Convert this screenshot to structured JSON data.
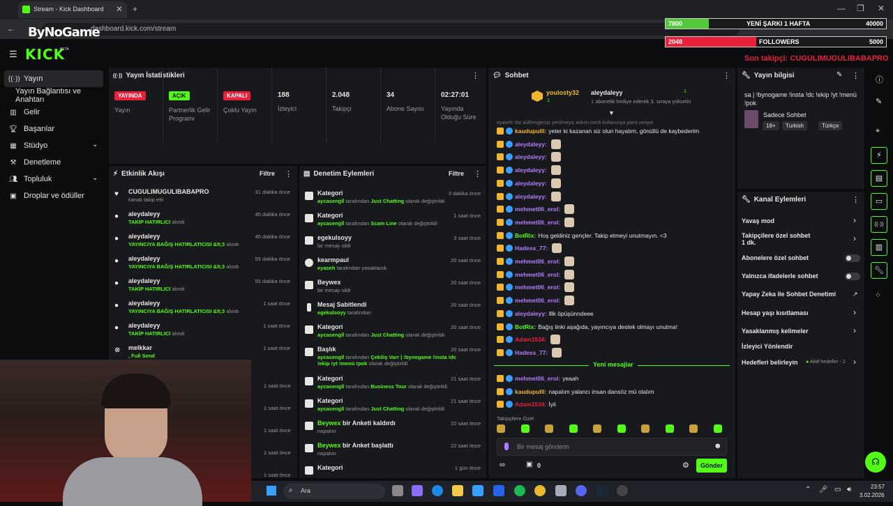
{
  "browser": {
    "tab_title": "Stream - Kick Dashboard",
    "url": "dashboard.kick.com/stream",
    "overlay_logo": "ByNoGame"
  },
  "overlay": {
    "song_count": "7800",
    "song_label": "YENİ ŞARKI 1 HAFTA",
    "song_target": "40000",
    "follow_count": "2048",
    "follow_label": "FOLLOWERS",
    "follow_target": "5000",
    "last_follower": "Son takipçi: CUGULIMUGULIBABAPRO",
    "song_progress": 0.195,
    "follow_progress": 0.41
  },
  "kick": {
    "logo": "KICK",
    "beta": "BETA"
  },
  "sidebar": {
    "items": [
      {
        "label": "Yayın",
        "icon": "broadcast-icon"
      },
      {
        "label": "Yayın Bağlantısı ve Anahtarı",
        "icon": ""
      },
      {
        "label": "Gelir",
        "icon": "chart-icon"
      },
      {
        "label": "Başarılar",
        "icon": "trophy-icon"
      },
      {
        "label": "Stüdyo",
        "icon": "grid-icon"
      },
      {
        "label": "Denetleme",
        "icon": "hammer-icon"
      },
      {
        "label": "Topluluk",
        "icon": "users-icon"
      },
      {
        "label": "Droplar ve ödüller",
        "icon": "gift-icon"
      }
    ]
  },
  "stats": {
    "title": "Yayın İstatistikleri",
    "items": [
      {
        "badge": "YAYINDA",
        "label": "Yayın"
      },
      {
        "badge": "AÇIK",
        "label": "Partnerlik Gelir Programı"
      },
      {
        "badge": "KAPALI",
        "label": "Çoklu Yayın"
      },
      {
        "value": "188",
        "label": "İzleyici"
      },
      {
        "value": "2.048",
        "label": "Takipçi"
      },
      {
        "value": "34",
        "label": "Abone Sayısı"
      },
      {
        "value": "02:27:01",
        "label": "Yayında Olduğu Süre"
      }
    ]
  },
  "activity": {
    "title": "Etkinlik Akışı",
    "filter": "Filtre",
    "rows": [
      {
        "name": "CUGULIMUGULIBABAPRO",
        "sub": "",
        "sub2": "kanalı takip etti",
        "time": "31 dakika önce"
      },
      {
        "name": "aleydaleyy",
        "sub": "TAKİP HATIRLICI",
        "sub2": "alındı",
        "time": "45 dakika önce"
      },
      {
        "name": "aleydaleyy",
        "sub": "YAYINCIYA BAĞIŞ HATIRLATICISI &lt;3",
        "sub2": "alındı",
        "time": "45 dakika önce"
      },
      {
        "name": "aleydaleyy",
        "sub": "YAYINCIYA BAĞIŞ HATIRLATICISI &lt;3",
        "sub2": "alındı",
        "time": "55 dakika önce"
      },
      {
        "name": "aleydaleyy",
        "sub": "TAKİP HATIRLICI",
        "sub2": "alındı",
        "time": "55 dakika önce"
      },
      {
        "name": "aleydaleyy",
        "sub": "YAYINCIYA BAĞIŞ HATIRLATICISI &lt;3",
        "sub2": "alındı",
        "time": "1 saat önce"
      },
      {
        "name": "aleydaleyy",
        "sub": "TAKİP HATIRLICI",
        "sub2": "alındı",
        "time": "1 saat önce"
      },
      {
        "name": "melkkar",
        "sub": ", Full Send",
        "sub2": "",
        "time": "1 saat önce"
      }
    ],
    "extra_times": [
      "1 saat önce",
      "1 saat önce",
      "1 saat önce",
      "1 saat önce",
      "1 saat önce"
    ]
  },
  "moderation": {
    "title": "Denetim Eylemleri",
    "filter": "Filtre",
    "rows": [
      {
        "name": "Kategori",
        "g1": "aycasengll",
        "t1": " tarafından ",
        "g2": "Just Chatting",
        "t2": " olarak değiştirildi",
        "time": "3 dakika önce"
      },
      {
        "name": "Kategori",
        "g1": "aycasengll",
        "t1": " tarafından ",
        "g2": "Scam Line",
        "t2": " olarak değiştirildi",
        "time": "1 saat önce"
      },
      {
        "name": "egekulsoyy",
        "g1": "",
        "t1": "bir mesajı sildi",
        "g2": "",
        "t2": "",
        "time": "3 saat önce"
      },
      {
        "name": "kearmpaul",
        "g1": "eyaseh",
        "t1": " tarafından yasaklandı",
        "g2": "",
        "t2": "",
        "time": "20 saat önce"
      },
      {
        "name": "Beywex",
        "g1": "",
        "t1": "bir mesajı sildi",
        "g2": "",
        "t2": "",
        "time": "20 saat önce"
      },
      {
        "name": "Mesaj Sabitlendi",
        "g1": "egekulsoyy",
        "t1": " tarafından",
        "g2": "",
        "t2": "",
        "time": "20 saat önce"
      },
      {
        "name": "Kategori",
        "g1": "aycasengll",
        "t1": " tarafından ",
        "g2": "Just Chatting",
        "t2": " olarak değiştirildi",
        "time": "20 saat önce"
      },
      {
        "name": "Başlık",
        "g1": "aycasengll",
        "t1": " tarafından ",
        "g2": "Çekiliş Varr | !bynogame !insta !dc !ekip !yt !menü !pok",
        "t2": " olarak değiştirildi",
        "time": "20 saat önce"
      },
      {
        "name": "Kategori",
        "g1": "aycasengll",
        "t1": " tarafından ",
        "g2": "Business Tour",
        "t2": " olarak değiştirildi",
        "time": "21 saat önce"
      },
      {
        "name": "Kategori",
        "g1": "aycasengll",
        "t1": " tarafından ",
        "g2": "Just Chatting",
        "t2": " olarak değiştirildi",
        "time": "21 saat önce"
      },
      {
        "name": "bir Anketi kaldırdı",
        "gname": "Beywex",
        "g1": "",
        "t1": "napalım",
        "g2": "",
        "t2": "",
        "time": "22 saat önce"
      },
      {
        "name": "bir Anket başlattı",
        "gname": "Beywex",
        "g1": "",
        "t1": "napalım",
        "g2": "",
        "t2": "",
        "time": "22 saat önce"
      },
      {
        "name": "Kategori",
        "g1": "",
        "t1": "",
        "g2": "",
        "t2": "",
        "time": "1 gün önce"
      }
    ]
  },
  "chat": {
    "title": "Sohbet",
    "gifter": "youlosty32",
    "gifter_count": "1",
    "recipient": "aleydaleyy",
    "recipient_count": "1",
    "gift_note": "1 abonelik hediye ederek 3. sıraya yükselin",
    "pinned_preview": "eyaseh: biz külfemgersiz yenilmeyiz askım isimli kullanıcıya yanıt veriyor",
    "messages": [
      {
        "user": "kaudupulll",
        "text": "yeter ki kazanan siz olun hayatım, gönüllü de kaybederim",
        "color": "#f2b531"
      },
      {
        "user": "aleydaleyy",
        "text": "",
        "color": "#b57cff"
      },
      {
        "user": "aleydaleyy",
        "text": "",
        "color": "#b57cff"
      },
      {
        "user": "aleydaleyy",
        "text": "",
        "color": "#b57cff"
      },
      {
        "user": "aleydaleyy",
        "text": "",
        "color": "#b57cff"
      },
      {
        "user": "aleydaleyy",
        "text": "",
        "color": "#b57cff"
      },
      {
        "user": "mehmet06_erol",
        "text": "",
        "color": "#b57cff"
      },
      {
        "user": "mehmet06_erol",
        "text": "",
        "color": "#b57cff"
      },
      {
        "user": "BotRix",
        "text": "Hoş geldiniz gençler. Takip etmeyi unutmayın. <3",
        "color": "#53fc18"
      },
      {
        "user": "Hadess_77",
        "text": "",
        "color": "#b57cff"
      },
      {
        "user": "mehmet06_erol",
        "text": "",
        "color": "#b57cff"
      },
      {
        "user": "mehmet06_erol",
        "text": "",
        "color": "#b57cff"
      },
      {
        "user": "mehmet06_erol",
        "text": "",
        "color": "#b57cff"
      },
      {
        "user": "mehmet06_erol",
        "text": "",
        "color": "#b57cff"
      },
      {
        "user": "aleydaleyy",
        "text": "lllk öpüşünndeee",
        "color": "#b57cff"
      },
      {
        "user": "BotRix",
        "text": "Bağış linki aşağıda, yayıncıya destek olmayı unutma!",
        "color": "#53fc18"
      },
      {
        "user": "Adam1534",
        "text": "",
        "color": "#e8203a"
      },
      {
        "user": "Hadess_77",
        "text": "",
        "color": "#b57cff"
      }
    ],
    "new_messages": "Yeni mesajlar",
    "new": [
      {
        "user": "mehmet06_erol",
        "text": "yeaah",
        "color": "#b57cff"
      },
      {
        "user": "kaudupulll",
        "text": "napalım yalancı insan dansöz mü olalım",
        "color": "#f2b531"
      },
      {
        "user": "Adam1534",
        "text": "İyii",
        "color": "#e8203a"
      }
    ],
    "follower_only": "Takipçilere Özel",
    "input_placeholder": "Bir mesaj gönderin",
    "points": "0",
    "send": "Gönder"
  },
  "info": {
    "title": "Yayın bilgisi",
    "stream_title": "sa | !bynogame !insta !dc !ekip !yt !menü !pok",
    "category": "Sadece Sohbet",
    "tags": [
      "18+",
      "Turkish",
      "Türkçe"
    ]
  },
  "channel": {
    "title": "Kanal Eylemleri",
    "items": [
      {
        "label": "Yavaş mod",
        "extra": "",
        "type": "chev"
      },
      {
        "label": "Takipçilere özel sohbet",
        "extra": "1 dk.",
        "type": "chev"
      },
      {
        "label": "Abonelere özel sohbet",
        "extra": "",
        "type": "toggle"
      },
      {
        "label": "Yalnızca ifadelerle sohbet",
        "extra": "",
        "type": "toggle"
      },
      {
        "label": "Yapay Zeka ile Sohbet Denetimi",
        "extra": "",
        "type": "ext"
      },
      {
        "label": "Hesap yaşı kısıtlaması",
        "extra": "",
        "type": "chev"
      },
      {
        "label": "Yasaklanmış kelimeler",
        "extra": "",
        "type": "chev"
      },
      {
        "label": "İzleyici Yönlendir",
        "extra": "",
        "type": "none"
      },
      {
        "label": "Hedefleri belirleyin",
        "extra": "Aktif hedefler - 2",
        "type": "chev"
      }
    ]
  },
  "taskbar": {
    "search": "Ara",
    "time": "23:57",
    "date": "3.02.2026"
  }
}
